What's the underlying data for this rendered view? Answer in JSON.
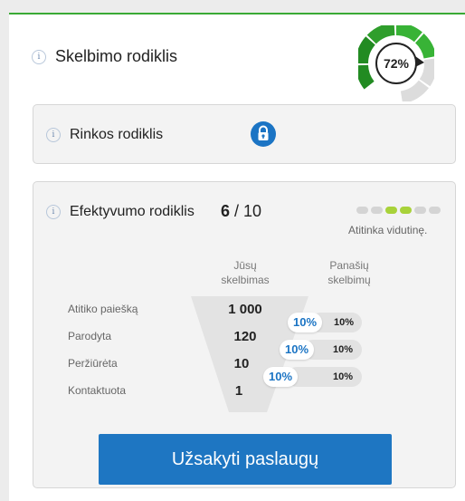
{
  "header": {
    "title": "Skelbimo rodiklis",
    "score_percent": 72,
    "score_label": "72%"
  },
  "market_card": {
    "title": "Rinkos rodiklis",
    "locked": true
  },
  "efficiency_card": {
    "title": "Efektyvumo rodiklis",
    "score_value": "6",
    "score_max": "/ 10",
    "level_bar": {
      "segments": 6,
      "active": [
        3,
        4
      ]
    },
    "level_label": "Atitinka vidutinę.",
    "columns": {
      "yours_line1": "Jūsų",
      "yours_line2": "skelbimas",
      "similar_line1": "Panašių",
      "similar_line2": "skelbimų"
    },
    "rows": [
      {
        "label": "Atitiko paiešką",
        "value": "1 000"
      },
      {
        "label": "Parodyta",
        "value": "120"
      },
      {
        "label": "Peržiūrėta",
        "value": "10"
      },
      {
        "label": "Kontaktuota",
        "value": "1"
      }
    ],
    "conversions": [
      {
        "yours": "10%",
        "similar": "10%"
      },
      {
        "yours": "10%",
        "similar": "10%"
      },
      {
        "yours": "10%",
        "similar": "10%"
      }
    ],
    "order_button": "Užsakyti paslaugų"
  },
  "colors": {
    "accent_green": "#3aaa35",
    "gauge_dark_green": "#228b22",
    "gauge_light_green": "#38b336",
    "brand_blue": "#1e76c2",
    "level_active": "#a8d23a"
  },
  "icons": [
    "info-icon",
    "lock-icon"
  ]
}
